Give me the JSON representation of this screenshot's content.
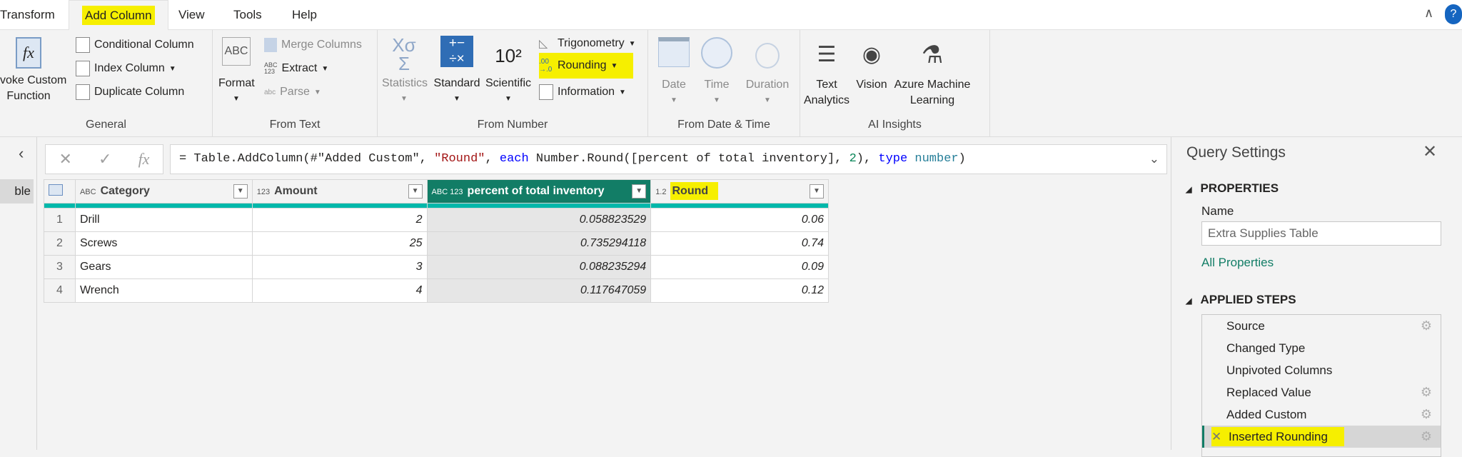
{
  "tabs": [
    "Transform",
    "Add Column",
    "View",
    "Tools",
    "Help"
  ],
  "active_tab": "Add Column",
  "ribbon": {
    "general": {
      "label": "General",
      "invoke": "Invoke Custom Function",
      "conditional": "Conditional Column",
      "index": "Index Column",
      "duplicate": "Duplicate Column"
    },
    "from_text": {
      "label": "From Text",
      "format": "Format",
      "merge": "Merge Columns",
      "extract": "Extract",
      "parse": "Parse"
    },
    "from_number": {
      "label": "From Number",
      "statistics": "Statistics",
      "standard": "Standard",
      "scientific": "Scientific",
      "trigonometry": "Trigonometry",
      "rounding": "Rounding",
      "information": "Information"
    },
    "from_date": {
      "label": "From Date & Time",
      "date": "Date",
      "time": "Time",
      "duration": "Duration"
    },
    "ai": {
      "label": "AI Insights",
      "text": "Text Analytics",
      "vision": "Vision",
      "azure": "Azure Machine Learning"
    }
  },
  "nav": {
    "query_fragment": "ble"
  },
  "formula": {
    "prefix": "= Table.AddColumn(#\"Added Custom\", ",
    "str": "\"Round\"",
    "comma": ", ",
    "each": "each",
    "mid": " Number.Round([percent of total inventory], ",
    "two": "2",
    "close": "), ",
    "type": "type",
    "space": " ",
    "number": "number",
    "end": ")"
  },
  "table": {
    "columns": [
      {
        "type": "ABC",
        "name": "Category"
      },
      {
        "type": "123",
        "name": "Amount"
      },
      {
        "type": "ABC 123",
        "name": "percent of total inventory"
      },
      {
        "type": "1.2",
        "name": "Round"
      }
    ],
    "rows": [
      [
        "1",
        "Drill",
        "2",
        "0.058823529",
        "0.06"
      ],
      [
        "2",
        "Screws",
        "25",
        "0.735294118",
        "0.74"
      ],
      [
        "3",
        "Gears",
        "3",
        "0.088235294",
        "0.09"
      ],
      [
        "4",
        "Wrench",
        "4",
        "0.117647059",
        "0.12"
      ]
    ]
  },
  "panel": {
    "title": "Query Settings",
    "properties": "PROPERTIES",
    "name_label": "Name",
    "name_value": "Extra Supplies Table",
    "all_props": "All Properties",
    "applied_steps": "APPLIED STEPS",
    "steps": [
      "Source",
      "Changed Type",
      "Unpivoted Columns",
      "Replaced Value",
      "Added Custom",
      "Inserted Rounding"
    ]
  },
  "colors": {
    "accent": "#127d66",
    "highlight": "#f6ef00",
    "teal_strip": "#01b8aa"
  }
}
